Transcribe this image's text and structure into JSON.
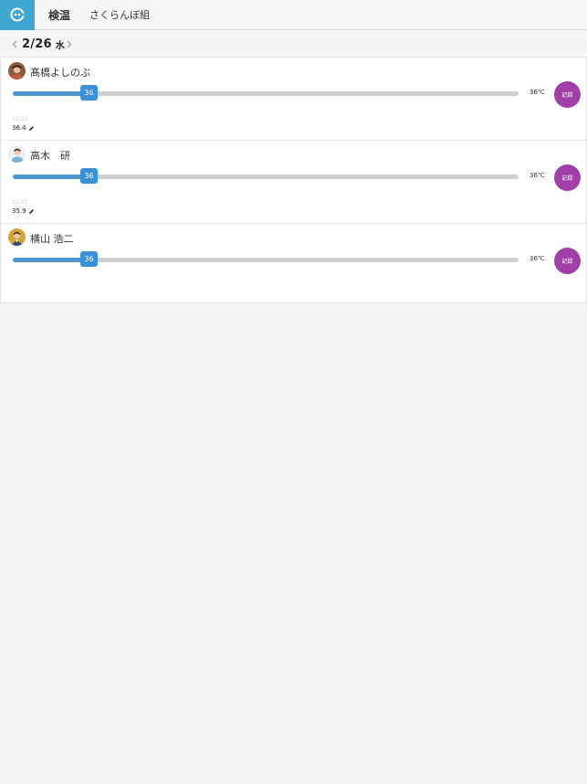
{
  "header": {
    "title": "検温",
    "group": "さくらんぼ組"
  },
  "date": {
    "date": "2/26",
    "weekday": "水"
  },
  "colors": {
    "brand": "#3ea6d1",
    "slider_fill": "#4a97d3",
    "record_button": "#a13fa9"
  },
  "children": [
    {
      "name": "髙橋よしのぶ",
      "slider_value": "36",
      "unit": "36℃",
      "record_label": "記録",
      "last_time": "11:22",
      "last_temp": "36.4"
    },
    {
      "name": "高木　研",
      "slider_value": "36",
      "unit": "36℃",
      "record_label": "記録",
      "last_time": "11:22",
      "last_temp": "35.9"
    },
    {
      "name": "横山 浩二",
      "slider_value": "36",
      "unit": "36℃",
      "record_label": "記録"
    }
  ]
}
